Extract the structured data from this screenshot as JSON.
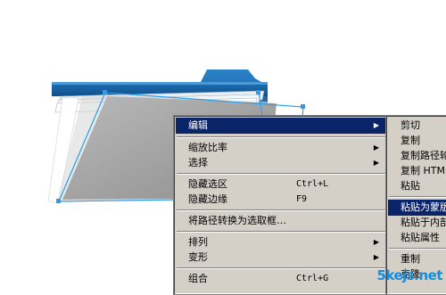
{
  "context_menu": {
    "items": [
      {
        "label": "编辑",
        "shortcut": "",
        "submenu": true,
        "highlighted": true
      },
      {
        "label": "缩放比率",
        "shortcut": "",
        "submenu": true,
        "highlighted": false
      },
      {
        "label": "选择",
        "shortcut": "",
        "submenu": true,
        "highlighted": false
      },
      {
        "label": "隐藏选区",
        "shortcut": "Ctrl+L",
        "submenu": false,
        "highlighted": false
      },
      {
        "label": "隐藏边缘",
        "shortcut": "F9",
        "submenu": false,
        "highlighted": false
      },
      {
        "label": "将路径转换为选取框…",
        "shortcut": "",
        "submenu": false,
        "highlighted": false
      },
      {
        "label": "排列",
        "shortcut": "",
        "submenu": true,
        "highlighted": false
      },
      {
        "label": "变形",
        "shortcut": "",
        "submenu": true,
        "highlighted": false
      },
      {
        "label": "组合",
        "shortcut": "Ctrl+G",
        "submenu": false,
        "highlighted": false
      }
    ]
  },
  "submenu": {
    "items": [
      {
        "label": "剪切",
        "highlighted": false
      },
      {
        "label": "复制",
        "highlighted": false
      },
      {
        "label": "复制路径轮",
        "highlighted": false
      },
      {
        "label": "复制 HTML",
        "highlighted": false
      },
      {
        "label": "粘贴",
        "highlighted": false
      },
      {
        "label": "粘贴为蒙版",
        "highlighted": true
      },
      {
        "label": "粘贴于内部",
        "highlighted": false
      },
      {
        "label": "粘贴属性",
        "highlighted": false
      },
      {
        "label": "重制",
        "highlighted": false
      },
      {
        "label": "克隆",
        "highlighted": false
      }
    ]
  },
  "watermark": "5kejs.net",
  "colors": {
    "menu_bg": "#d4d0c8",
    "highlight": "#0a246a",
    "folder_blue": "#1f6fb2",
    "selection_line": "#2a9de8"
  }
}
